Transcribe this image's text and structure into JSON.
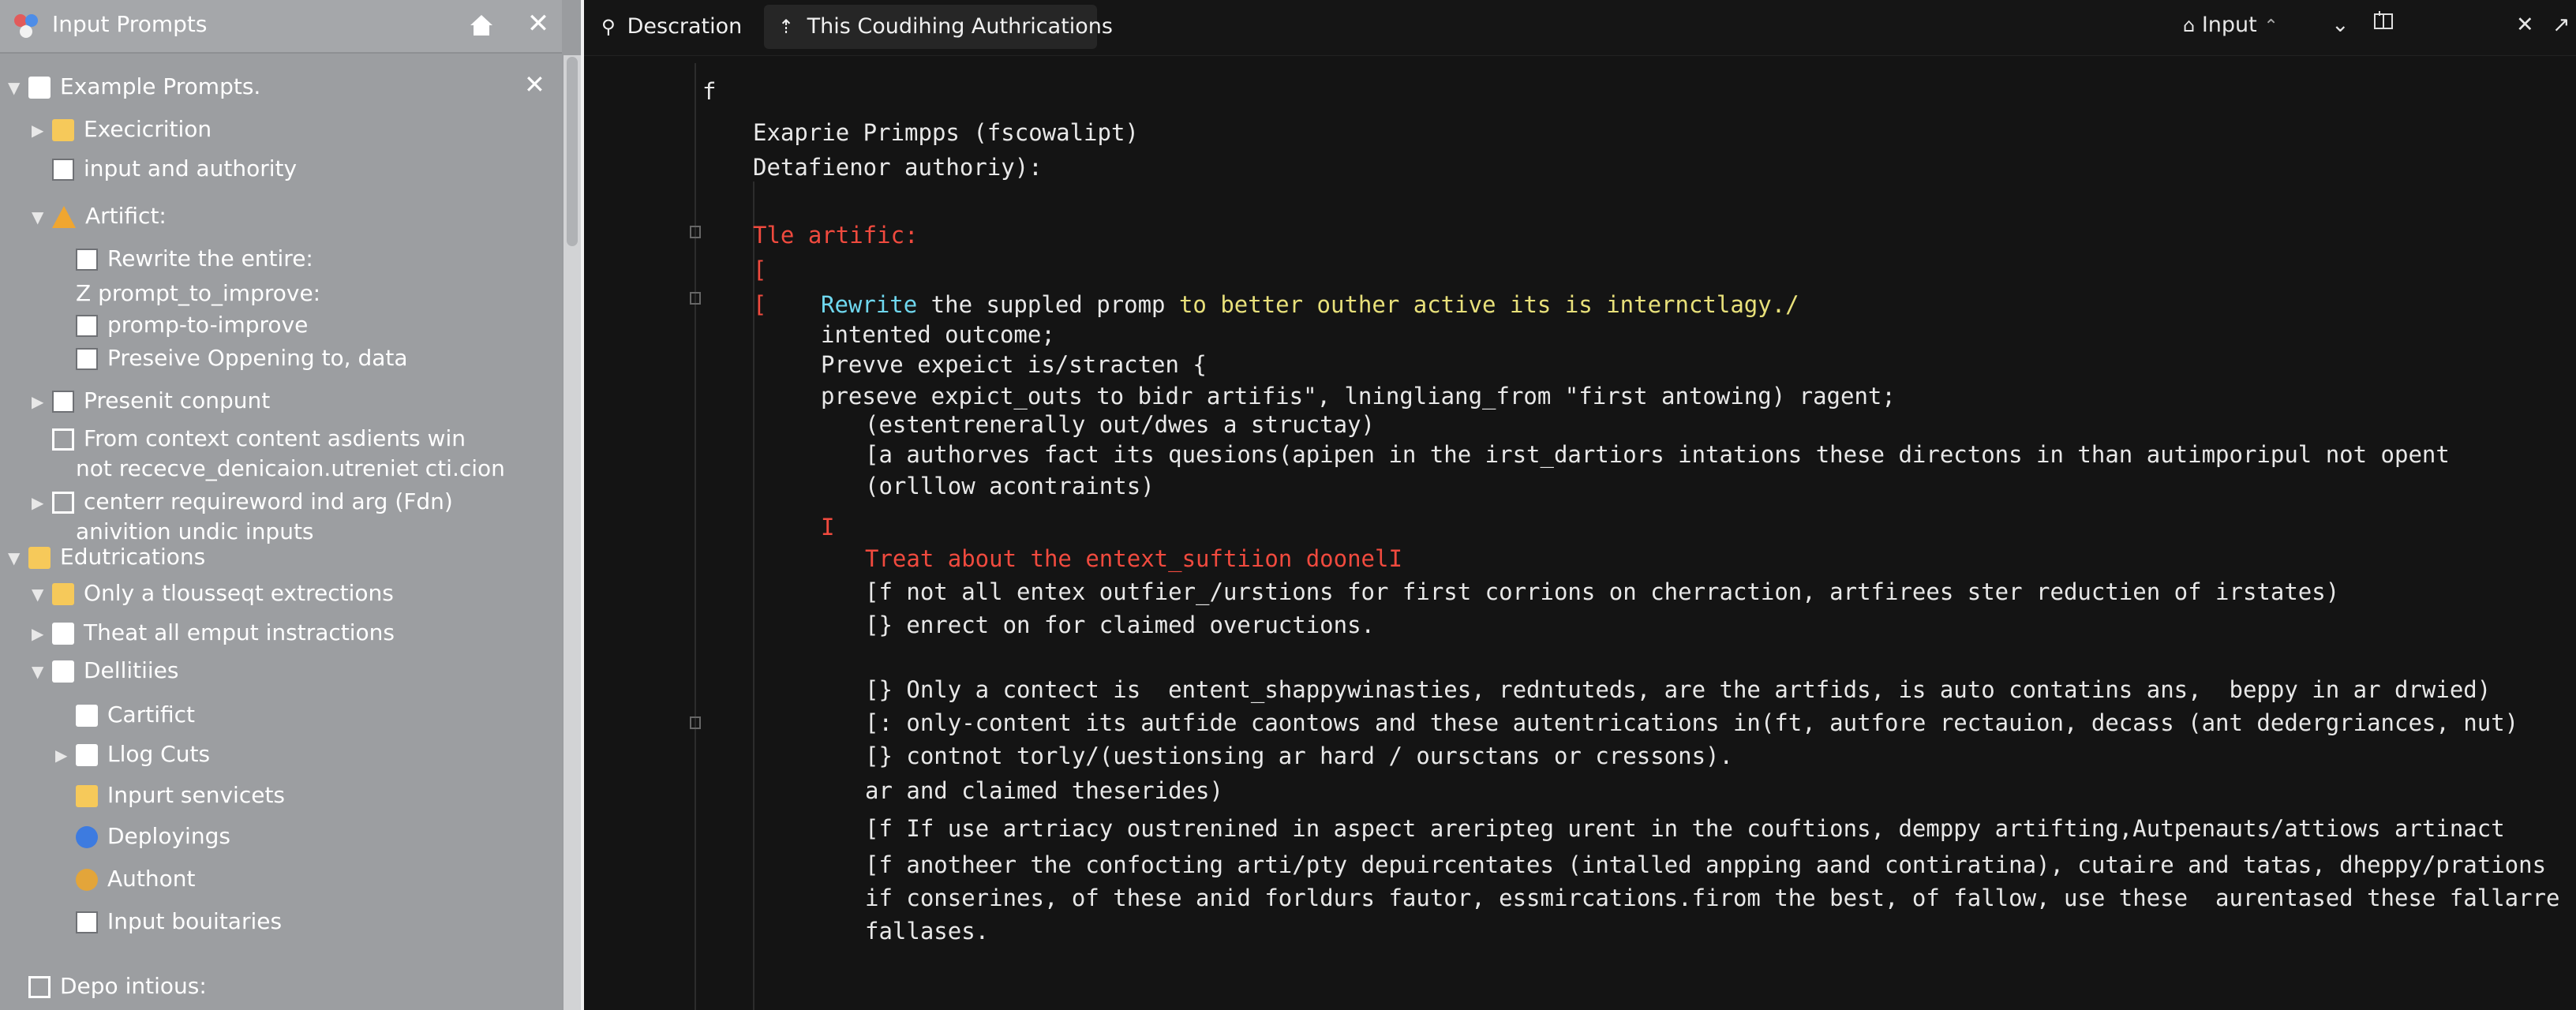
{
  "sidebar": {
    "title": "Input Prompts",
    "icons": {
      "app": "app-logo-icon",
      "home": "home-icon",
      "close": "close-icon"
    },
    "items": [
      {
        "label": "Example Prompts.",
        "arrow": "▼",
        "icon": "home-icon",
        "level": 0
      },
      {
        "label": "Execicrition",
        "arrow": "▶",
        "icon": "folder-icon",
        "level": 1
      },
      {
        "label": "input and authority",
        "arrow": "",
        "icon": "document-icon",
        "level": 1
      },
      {
        "label": "Artifict:",
        "arrow": "▼",
        "icon": "warning-icon",
        "level": 1
      },
      {
        "label": "Rewrite the entire:",
        "arrow": "",
        "icon": "document-icon",
        "level": 2
      },
      {
        "label": "Z prompt_to_improve:",
        "arrow": "",
        "icon": "",
        "level": 2
      },
      {
        "label": "promp-to-improve",
        "arrow": "",
        "icon": "document-icon",
        "level": 2
      },
      {
        "label": "Preseive Oppening to, data",
        "arrow": "",
        "icon": "document-icon",
        "level": 2
      },
      {
        "label": "Presenit conpunt",
        "arrow": "▶",
        "icon": "document-icon",
        "level": 1
      },
      {
        "label": "From context content asdients win",
        "arrow": "",
        "icon": "document-outline-icon",
        "level": 1
      },
      {
        "label": "not rececve_denicaion.utreniet cti.cion",
        "arrow": "",
        "icon": "",
        "level": 2
      },
      {
        "label": "centerr requireword ind arg (Fdn)",
        "arrow": "▶",
        "icon": "document-outline-icon",
        "level": 1
      },
      {
        "label": "anivition undic inputs",
        "arrow": "",
        "icon": "",
        "level": 2
      },
      {
        "label": "Edutrications",
        "arrow": "▼",
        "icon": "folder-icon",
        "level": 0
      },
      {
        "label": "Only a tlousseqt extrections",
        "arrow": "▼",
        "icon": "folder-icon",
        "level": 1
      },
      {
        "label": "Theat all emput instractions",
        "arrow": "▶",
        "icon": "folder-white-icon",
        "level": 1
      },
      {
        "label": "Dellitiies",
        "arrow": "▼",
        "icon": "folder-white-icon",
        "level": 1
      },
      {
        "label": "Cartifict",
        "arrow": "",
        "icon": "folder-white-icon",
        "level": 2
      },
      {
        "label": "Llog Cuts",
        "arrow": "▶",
        "icon": "folder-white-icon",
        "level": 2
      },
      {
        "label": "Inpurt senvicets",
        "arrow": "",
        "icon": "image-icon",
        "level": 2
      },
      {
        "label": "Deployings",
        "arrow": "",
        "icon": "puzzle-icon",
        "level": 2
      },
      {
        "label": "Authont",
        "arrow": "",
        "icon": "gear-icon",
        "level": 2
      },
      {
        "label": "Input bouitaries",
        "arrow": "",
        "icon": "document-icon",
        "level": 2
      },
      {
        "label": "Depo intious:",
        "arrow": "",
        "icon": "inbox-icon",
        "level": 0
      }
    ]
  },
  "tabs": [
    {
      "label": "Descration",
      "icon": "pin-icon"
    },
    {
      "label": "This Coudihing Authrications",
      "icon": "arrow-up-icon"
    }
  ],
  "toolbar": {
    "input_label": "Input",
    "icons": [
      "lock-icon",
      "chevron-up-icon",
      "chevron-down-icon",
      "split-icon",
      "close-icon",
      "expand-icon"
    ]
  },
  "code": [
    {
      "text": "f",
      "indent": 0,
      "color": "default"
    },
    {
      "text": "Exaprie Primpps (fscowalipt)",
      "indent": 1,
      "color": "default"
    },
    {
      "text": "Detafienor authoriy):",
      "indent": 1,
      "color": "default"
    },
    {
      "text": "Tle artific:",
      "indent": 1,
      "color": "red"
    },
    {
      "text": "[",
      "indent": 1,
      "color": "red"
    },
    {
      "text": "[",
      "indent": 1,
      "color": "red"
    },
    {
      "text": "Rewrite the suppled promp to better outher active its is internctlagy./",
      "indent": 2,
      "color": "mixed"
    },
    {
      "text": "intented outcome;",
      "indent": 2,
      "color": "default"
    },
    {
      "text": "Prevve expeict is/stracten {",
      "indent": 2,
      "color": "default"
    },
    {
      "text": "preseve expict_outs to bidr artifis\", lningliang_from \"first antowing) ragent;",
      "indent": 2,
      "color": "default"
    },
    {
      "text": "(estentrenerally out/dwes a structay)",
      "indent": 3,
      "color": "default"
    },
    {
      "text": "[a authorves fact its quesions(apipen in the irst_dartiors intations these directons in than autimporipul not opent",
      "indent": 3,
      "color": "default"
    },
    {
      "text": "(orlllow acontraints)",
      "indent": 3,
      "color": "default"
    },
    {
      "text": "I",
      "indent": 2,
      "color": "red"
    },
    {
      "text": "Treat about the entext_suftiion doonelI",
      "indent": 3,
      "color": "red"
    },
    {
      "text": "[f not all entex outfier_/urstions for first corrions on cherraction, artfirees ster reductien of irstates)",
      "indent": 3,
      "color": "default"
    },
    {
      "text": "[} enrect on for claimed oveructions.",
      "indent": 3,
      "color": "default"
    },
    {
      "text": "[} Only a contect is  entent_shappywinasties, redntuteds, are the artfids, is auto contatins ans,  beppy in ar drwied)",
      "indent": 3,
      "color": "default"
    },
    {
      "text": "[: only-content its autfide caontows and these autentrications in(ft, autfore rectauion, decass (ant dedergriances, nut)",
      "indent": 3,
      "color": "default"
    },
    {
      "text": "[} contnot torly/(uestionsing ar hard / oursctans or cressons).",
      "indent": 3,
      "color": "default"
    },
    {
      "text": "ar and claimed theserides)",
      "indent": 3,
      "color": "default"
    },
    {
      "text": "[f If use artriacy oustrenined in aspect areripteg urent in the couftions, demppy artifting,Autpenauts/attiows artinact",
      "indent": 3,
      "color": "default"
    },
    {
      "text": "[f anotheer the confocting arti/pty depuircentates (intalled anpping aand contiratina), cutaire and tatas, dheppy/prations",
      "indent": 3,
      "color": "default"
    },
    {
      "text": "if conserines, of these anid forldurs fautor, essmircations.firom the best, of fallow, use these  aurentased these fallarre",
      "indent": 3,
      "color": "default"
    },
    {
      "text": "fallases.",
      "indent": 3,
      "color": "default"
    }
  ],
  "colors": {
    "sidebar_bg": "#9c9ea1",
    "editor_bg": "#141414",
    "keyword_red": "#f04a3e",
    "keyword_cyan": "#6fd7ee",
    "string_yellow": "#e8e07a"
  }
}
